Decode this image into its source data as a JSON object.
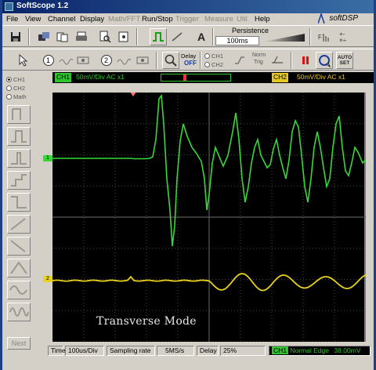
{
  "window": {
    "title": "SoftScope 1.2"
  },
  "menu": {
    "items": [
      {
        "label": "File",
        "enabled": true
      },
      {
        "label": "View",
        "enabled": true
      },
      {
        "label": "Channel",
        "enabled": true
      },
      {
        "label": "Display",
        "enabled": true
      },
      {
        "label": "Math/FFT",
        "enabled": false
      },
      {
        "label": "Run/Stop",
        "enabled": true
      },
      {
        "label": "Trigger",
        "enabled": false
      },
      {
        "label": "Measure",
        "enabled": false
      },
      {
        "label": "Util",
        "enabled": false
      },
      {
        "label": "Help",
        "enabled": true
      }
    ],
    "brand": "softDSP"
  },
  "toolbar": {
    "persistence_label": "Persistence",
    "persistence_value": "100ms",
    "text_tool": "A",
    "fft_label": "FFT",
    "math_label": "+-\n×÷"
  },
  "toolbar2": {
    "cursor1": "1",
    "cursor2": "2",
    "delay_label": "Delay",
    "delay_value": "OFF",
    "ch1_option": "CH1",
    "ch2_option": "CH2",
    "norm_label": "Norm",
    "trig_label": "Trig",
    "autoset_line1": "AUTO",
    "autoset_line2": "SET"
  },
  "side": {
    "ch1_option": "CH1",
    "ch2_option": "CH2",
    "math_option": "Math",
    "next_label": "Next"
  },
  "channel_bar": {
    "ch1_tag": "CH1",
    "ch1_setting": "50mV/Div AC x1",
    "ch2_tag": "CH2",
    "ch2_setting": "50mV/Div AC x1"
  },
  "scope": {
    "overlay_text": "Transverse Mode",
    "ch1_marker": "1",
    "ch2_marker": "2",
    "colors": {
      "ch1": "#39d839",
      "ch2": "#e8d21c",
      "grid": "#5a5a5a"
    }
  },
  "status": {
    "time_label": "Time",
    "time_value": "100us/Div",
    "sampling_label": "Sampling rate",
    "sampling_value": "5MS/s",
    "delay_label": "Delay",
    "delay_value": "25%",
    "trigger_channel": "CH1",
    "trigger_mode": "Normal Edge",
    "trigger_level": "38.00mV"
  }
}
